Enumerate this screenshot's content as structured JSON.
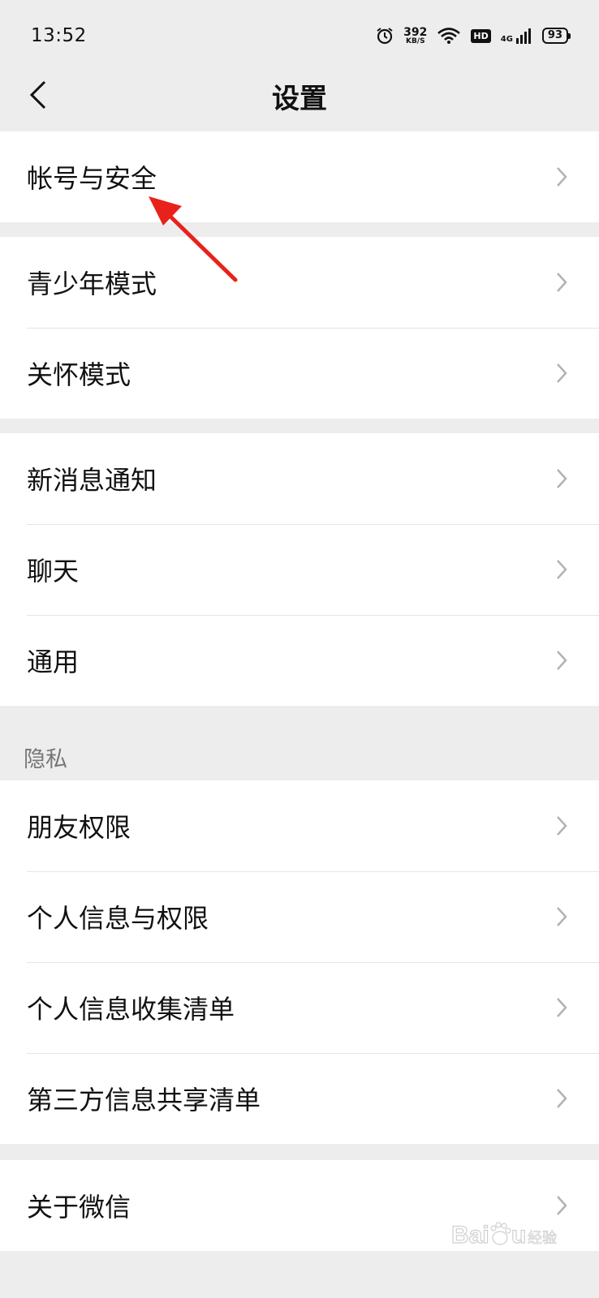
{
  "status_bar": {
    "time": "13:52",
    "speed_value": "392",
    "speed_unit": "KB/S",
    "hd_label": "HD",
    "network_label": "4G",
    "battery_level": "93"
  },
  "nav": {
    "title": "设置"
  },
  "groups": [
    {
      "items": [
        {
          "label": "帐号与安全"
        }
      ]
    },
    {
      "items": [
        {
          "label": "青少年模式"
        },
        {
          "label": "关怀模式"
        }
      ]
    },
    {
      "items": [
        {
          "label": "新消息通知"
        },
        {
          "label": "聊天"
        },
        {
          "label": "通用"
        }
      ]
    },
    {
      "header": "隐私",
      "items": [
        {
          "label": "朋友权限"
        },
        {
          "label": "个人信息与权限"
        },
        {
          "label": "个人信息收集清单"
        },
        {
          "label": "第三方信息共享清单"
        }
      ]
    },
    {
      "items": [
        {
          "label": "关于微信"
        }
      ]
    }
  ],
  "watermark": {
    "text": "Baidu 经验"
  },
  "colors": {
    "background": "#ededed",
    "card": "#ffffff",
    "annotation_arrow": "#e8221b"
  }
}
